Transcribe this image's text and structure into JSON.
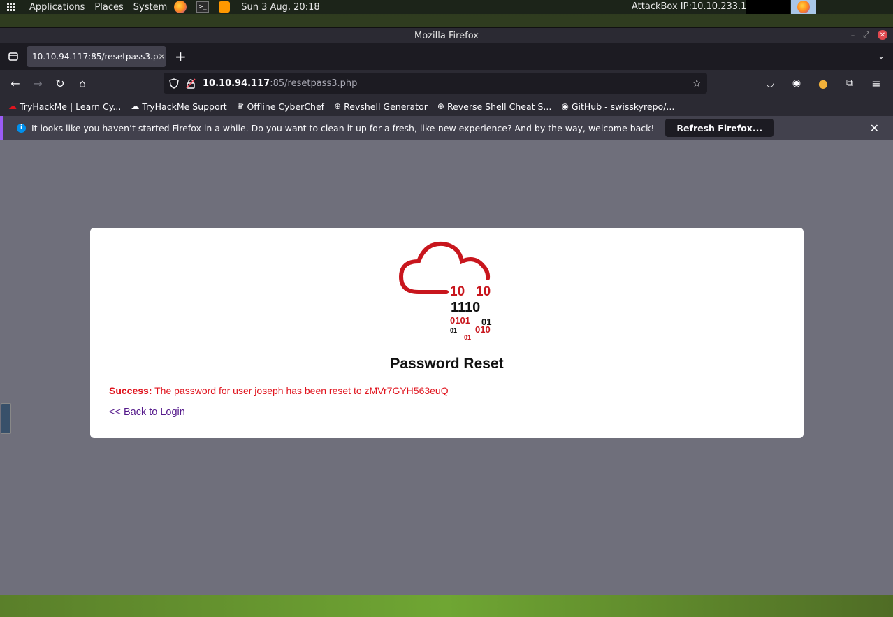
{
  "system_panel": {
    "menu": [
      "Applications",
      "Places",
      "System"
    ],
    "clock": "Sun 3 Aug, 20:18",
    "attackbox_ip": "AttackBox IP:10.10.233.108"
  },
  "window": {
    "title": "Mozilla Firefox"
  },
  "tab": {
    "title": "10.10.94.117:85/resetpass3.p"
  },
  "url": {
    "host": "10.10.94.117",
    "rest": ":85/resetpass3.php"
  },
  "bookmarks": [
    {
      "label": "TryHackMe | Learn Cy...",
      "icon": "tryhackme-icon"
    },
    {
      "label": "TryHackMe Support",
      "icon": "cloud-icon"
    },
    {
      "label": "Offline CyberChef",
      "icon": "chef-hat-icon"
    },
    {
      "label": "Revshell Generator",
      "icon": "globe-icon"
    },
    {
      "label": "Reverse Shell Cheat S...",
      "icon": "globe-icon"
    },
    {
      "label": "GitHub - swisskyrepo/...",
      "icon": "github-icon"
    }
  ],
  "notification": {
    "text": "It looks like you haven’t started Firefox in a while. Do you want to clean it up for a fresh, like-new experience? And by the way, welcome back!",
    "button": "Refresh Firefox..."
  },
  "page": {
    "logo_binary": [
      "10",
      "10",
      "1110",
      "0101",
      "01",
      "01",
      "010",
      "01"
    ],
    "heading": "Password Reset",
    "success_label": "Success:",
    "success_text": " The password for user joseph has been reset to zMVr7GYH563euQ",
    "back_link": "<< Back to Login"
  },
  "colors": {
    "page_bg": "#6f6f7b",
    "success_red": "#e0141e",
    "logo_red": "#c8161d",
    "link_purple": "#551a8b"
  }
}
